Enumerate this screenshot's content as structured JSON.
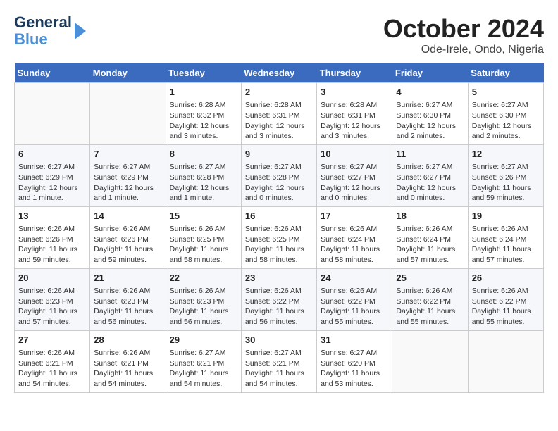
{
  "header": {
    "logo_line1": "General",
    "logo_line2": "Blue",
    "month_title": "October 2024",
    "location": "Ode-Irele, Ondo, Nigeria"
  },
  "weekdays": [
    "Sunday",
    "Monday",
    "Tuesday",
    "Wednesday",
    "Thursday",
    "Friday",
    "Saturday"
  ],
  "weeks": [
    [
      {
        "day": "",
        "info": ""
      },
      {
        "day": "",
        "info": ""
      },
      {
        "day": "1",
        "info": "Sunrise: 6:28 AM\nSunset: 6:32 PM\nDaylight: 12 hours and 3 minutes."
      },
      {
        "day": "2",
        "info": "Sunrise: 6:28 AM\nSunset: 6:31 PM\nDaylight: 12 hours and 3 minutes."
      },
      {
        "day": "3",
        "info": "Sunrise: 6:28 AM\nSunset: 6:31 PM\nDaylight: 12 hours and 3 minutes."
      },
      {
        "day": "4",
        "info": "Sunrise: 6:27 AM\nSunset: 6:30 PM\nDaylight: 12 hours and 2 minutes."
      },
      {
        "day": "5",
        "info": "Sunrise: 6:27 AM\nSunset: 6:30 PM\nDaylight: 12 hours and 2 minutes."
      }
    ],
    [
      {
        "day": "6",
        "info": "Sunrise: 6:27 AM\nSunset: 6:29 PM\nDaylight: 12 hours and 1 minute."
      },
      {
        "day": "7",
        "info": "Sunrise: 6:27 AM\nSunset: 6:29 PM\nDaylight: 12 hours and 1 minute."
      },
      {
        "day": "8",
        "info": "Sunrise: 6:27 AM\nSunset: 6:28 PM\nDaylight: 12 hours and 1 minute."
      },
      {
        "day": "9",
        "info": "Sunrise: 6:27 AM\nSunset: 6:28 PM\nDaylight: 12 hours and 0 minutes."
      },
      {
        "day": "10",
        "info": "Sunrise: 6:27 AM\nSunset: 6:27 PM\nDaylight: 12 hours and 0 minutes."
      },
      {
        "day": "11",
        "info": "Sunrise: 6:27 AM\nSunset: 6:27 PM\nDaylight: 12 hours and 0 minutes."
      },
      {
        "day": "12",
        "info": "Sunrise: 6:27 AM\nSunset: 6:26 PM\nDaylight: 11 hours and 59 minutes."
      }
    ],
    [
      {
        "day": "13",
        "info": "Sunrise: 6:26 AM\nSunset: 6:26 PM\nDaylight: 11 hours and 59 minutes."
      },
      {
        "day": "14",
        "info": "Sunrise: 6:26 AM\nSunset: 6:26 PM\nDaylight: 11 hours and 59 minutes."
      },
      {
        "day": "15",
        "info": "Sunrise: 6:26 AM\nSunset: 6:25 PM\nDaylight: 11 hours and 58 minutes."
      },
      {
        "day": "16",
        "info": "Sunrise: 6:26 AM\nSunset: 6:25 PM\nDaylight: 11 hours and 58 minutes."
      },
      {
        "day": "17",
        "info": "Sunrise: 6:26 AM\nSunset: 6:24 PM\nDaylight: 11 hours and 58 minutes."
      },
      {
        "day": "18",
        "info": "Sunrise: 6:26 AM\nSunset: 6:24 PM\nDaylight: 11 hours and 57 minutes."
      },
      {
        "day": "19",
        "info": "Sunrise: 6:26 AM\nSunset: 6:24 PM\nDaylight: 11 hours and 57 minutes."
      }
    ],
    [
      {
        "day": "20",
        "info": "Sunrise: 6:26 AM\nSunset: 6:23 PM\nDaylight: 11 hours and 57 minutes."
      },
      {
        "day": "21",
        "info": "Sunrise: 6:26 AM\nSunset: 6:23 PM\nDaylight: 11 hours and 56 minutes."
      },
      {
        "day": "22",
        "info": "Sunrise: 6:26 AM\nSunset: 6:23 PM\nDaylight: 11 hours and 56 minutes."
      },
      {
        "day": "23",
        "info": "Sunrise: 6:26 AM\nSunset: 6:22 PM\nDaylight: 11 hours and 56 minutes."
      },
      {
        "day": "24",
        "info": "Sunrise: 6:26 AM\nSunset: 6:22 PM\nDaylight: 11 hours and 55 minutes."
      },
      {
        "day": "25",
        "info": "Sunrise: 6:26 AM\nSunset: 6:22 PM\nDaylight: 11 hours and 55 minutes."
      },
      {
        "day": "26",
        "info": "Sunrise: 6:26 AM\nSunset: 6:22 PM\nDaylight: 11 hours and 55 minutes."
      }
    ],
    [
      {
        "day": "27",
        "info": "Sunrise: 6:26 AM\nSunset: 6:21 PM\nDaylight: 11 hours and 54 minutes."
      },
      {
        "day": "28",
        "info": "Sunrise: 6:26 AM\nSunset: 6:21 PM\nDaylight: 11 hours and 54 minutes."
      },
      {
        "day": "29",
        "info": "Sunrise: 6:27 AM\nSunset: 6:21 PM\nDaylight: 11 hours and 54 minutes."
      },
      {
        "day": "30",
        "info": "Sunrise: 6:27 AM\nSunset: 6:21 PM\nDaylight: 11 hours and 54 minutes."
      },
      {
        "day": "31",
        "info": "Sunrise: 6:27 AM\nSunset: 6:20 PM\nDaylight: 11 hours and 53 minutes."
      },
      {
        "day": "",
        "info": ""
      },
      {
        "day": "",
        "info": ""
      }
    ]
  ]
}
